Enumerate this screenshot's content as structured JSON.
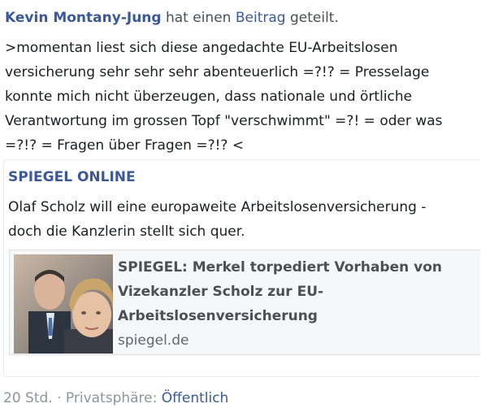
{
  "post": {
    "author": "Kevin Montany-Jung",
    "action_pre": " hat einen ",
    "action_link": "Beitrag",
    "action_post": " geteilt.",
    "message_lines": [
      ">momentan liest sich diese angedachte EU-Arbeitslosen",
      "versicherung sehr sehr sehr abenteuerlich =?!? = Presselage",
      "konnte mich nicht überzeugen, dass nationale und örtliche",
      "Verantwortung im grossen Topf \"verschwimmt\"  =?! = oder was",
      "=?!? = Fragen über Fragen =?!? <"
    ]
  },
  "shared": {
    "source": "SPIEGEL ONLINE",
    "teaser_lines": [
      "Olaf Scholz will eine europaweite Arbeitslosenversicherung -",
      "doch die Kanzlerin stellt sich quer."
    ],
    "card": {
      "title_lines": [
        "SPIEGEL: Merkel torpediert Vorhaben von",
        "Vizekanzler Scholz zur EU-",
        "Arbeitslosenversicherung"
      ],
      "domain": "spiegel.de",
      "thumbnail_icon": "news-photo-thumbnail"
    }
  },
  "footer": {
    "time": "20 Std.",
    "separator": " · ",
    "privacy_label": "Privatsphäre: ",
    "privacy_value": "Öffentlich"
  },
  "colors": {
    "link": "#3b5998",
    "text": "#1c1e21",
    "muted": "#90949c"
  }
}
